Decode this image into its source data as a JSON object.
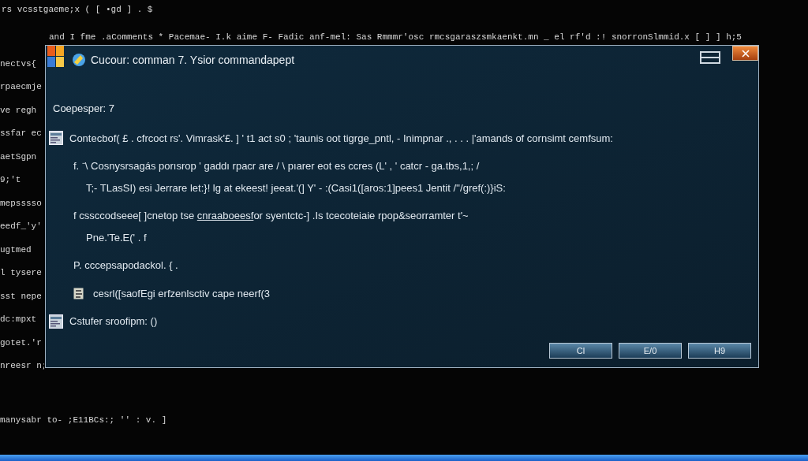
{
  "terminal": {
    "top_lines": [
      "rs  vcsstgaeme;x ( [ •gd ] .   $",
      "and I fme  .aComments  * Pacemae- I.k aime  F- Fadic anf-mel: Sas Rmmmr'osc  rmcsgaraszsmkaenkt.mn _ el  rf'd :!  snorronSlmmid.x  [ ]  ]    h;5"
    ],
    "left_lines": [
      "nectvs{",
      "rpaecmje",
      "ve  regh",
      "ssfar ec",
      "aetSgpn",
      "9;'t",
      "mepsssso",
      "eedf_'y'",
      "ugtmed",
      "l tysere",
      "sst nepe",
      "dc:mpxt",
      "gotet.'r",
      "nreesr n;"
    ],
    "bottom_line": "manysabr to- ;E11BCs:; '' : v.   ]"
  },
  "dialog": {
    "title": "Cucour: comman 7. Ysior commandapept",
    "heading": "Coepesper:  7",
    "entries": [
      {
        "kind": "icon-line",
        "text": "Contecbof( £ . cfrcoct rs'. Vimrask'£. ] ' t1 act s0 ; 'taunis oot tigrge_pntl, - Inimpnar ., . . . |'amands of cornsimt cemfsum:"
      },
      {
        "kind": "detail",
        "text": "f.    ⁻\\ Cosnysrsagás porısrop ' gaddı rpacr are  /     \\ pıarer eot es ccres (L' , '      catcr -  ga.tbs,1,; /"
      },
      {
        "kind": "subdetail",
        "text": "T;- TLasSI) esi Jerrare let:}! lg at ekeest! jeeat.'(] Y' -   :(Casi1([aros:1]pees1 Jentit /''/gref(:)}iS:"
      },
      {
        "kind": "link-line",
        "before": "f    cssccodseee[ ]cnetop tse ",
        "link": "cnraaboeesf",
        "after": "or syentctc-]   .Is tcecoteiaie rpop&seorramter t'~"
      },
      {
        "kind": "subdetail",
        "text": "Pne.'Te.E(' . f"
      },
      {
        "kind": "detail",
        "text": "P. cccepsapodackol. { ."
      },
      {
        "kind": "small-icon-line",
        "text": "cesrl([saofEgi erfzenlsctiv cape neerf(3"
      },
      {
        "kind": "icon-line",
        "text": "Cstufer sroofipm: ()"
      }
    ],
    "buttons": [
      "Cl",
      "E/0",
      "H9"
    ]
  }
}
